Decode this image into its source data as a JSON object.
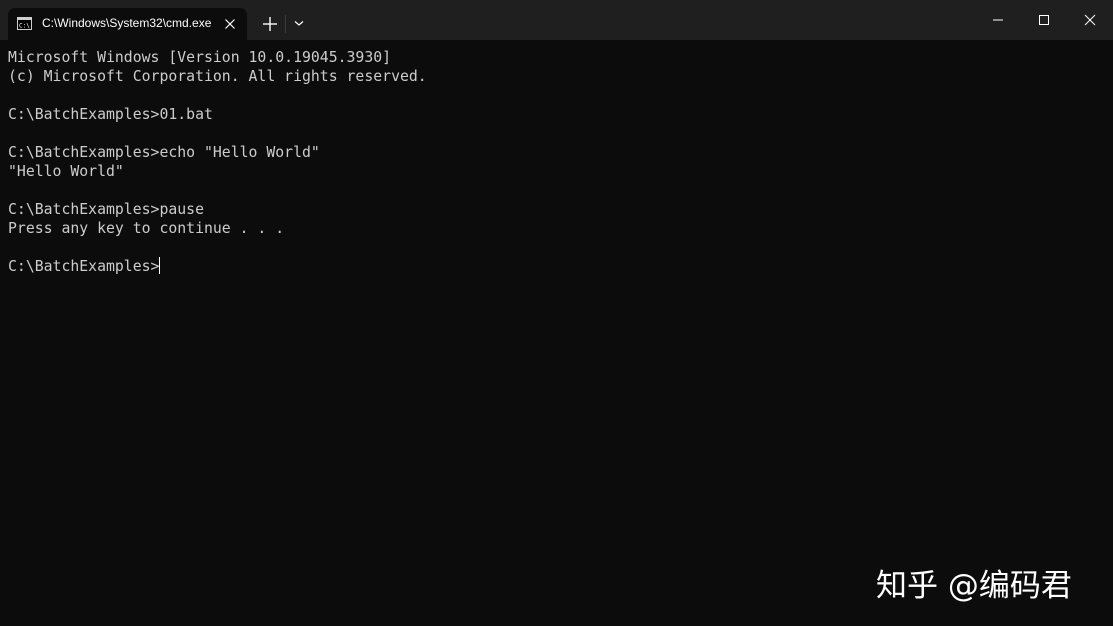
{
  "tab": {
    "title": "C:\\Windows\\System32\\cmd.exe",
    "icon": "cmd-icon",
    "close_icon": "close-icon"
  },
  "toolbar": {
    "new_tab_icon": "plus-icon",
    "dropdown_icon": "chevron-down-icon"
  },
  "window_controls": {
    "minimize_icon": "minimize-icon",
    "maximize_icon": "maximize-icon",
    "close_icon": "close-icon"
  },
  "console": {
    "lines": [
      "Microsoft Windows [Version 10.0.19045.3930]",
      "(c) Microsoft Corporation. All rights reserved.",
      "",
      "C:\\BatchExamples>01.bat",
      "",
      "C:\\BatchExamples>echo \"Hello World\"",
      "\"Hello World\"",
      "",
      "C:\\BatchExamples>pause",
      "Press any key to continue . . .",
      ""
    ],
    "prompt": "C:\\BatchExamples>"
  },
  "watermark": "知乎 @编码君",
  "colors": {
    "background": "#0c0c0c",
    "titlebar": "#1f1f1f",
    "text": "#cccccc"
  }
}
